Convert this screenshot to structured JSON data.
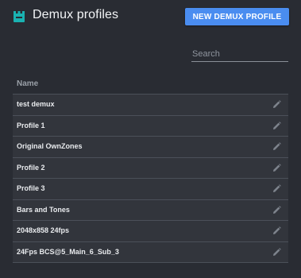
{
  "header": {
    "title": "Demux profiles",
    "icon": "demux-icon",
    "new_button_label": "NEW DEMUX PROFILE",
    "accent_color": "#4a8df0",
    "icon_color": "#1ab2b2"
  },
  "search": {
    "placeholder": "Search",
    "value": ""
  },
  "table": {
    "column_header": "Name",
    "edit_icon": "pencil-icon",
    "rows": [
      {
        "name": "test demux"
      },
      {
        "name": "Profile 1"
      },
      {
        "name": "Original OwnZones"
      },
      {
        "name": "Profile 2"
      },
      {
        "name": "Profile 3"
      },
      {
        "name": "Bars and Tones"
      },
      {
        "name": "2048x858 24fps"
      },
      {
        "name": "24Fps BCS@5_Main_6_Sub_3"
      }
    ]
  }
}
